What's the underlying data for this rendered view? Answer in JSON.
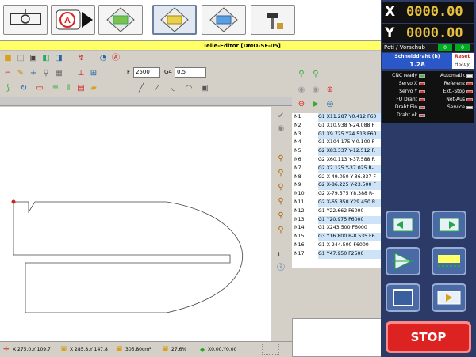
{
  "window_title": "Teile-Editor [DMO-SF-05]",
  "toolbar_icons": [
    "machine-icon",
    "auto-mode-icon",
    "diamond-folder-icon",
    "diamond-folder-edit-icon",
    "diamond-folder-open-icon",
    "hammer-icon"
  ],
  "row2_icons": [
    "open-folder-icon",
    "new-file-icon",
    "save-icon",
    "import-icon",
    "export-icon",
    "cursor-cut-icon",
    "timer-icon",
    "auto-icon"
  ],
  "row3": {
    "feed_label": "F",
    "feed_value": "2500",
    "g4_label": "G4",
    "g4_value": "0.5"
  },
  "right_panel": {
    "x_label": "X",
    "x_value": "0000.00",
    "y_label": "Y",
    "y_value": "0000.00",
    "poti_label": "Poti / Vorschub",
    "poti_a": "0",
    "poti_b": "0",
    "wire_title": "Schneiddraht (h)",
    "wire_value": "1.28",
    "reset": "Reset",
    "history": "Histoy",
    "status_left": [
      "CNC ready",
      "Servo X",
      "Servo Y",
      "FU Draht",
      "Draht Ein",
      "Draht ok"
    ],
    "status_left_colors": [
      "green",
      "red",
      "red",
      "red",
      "red",
      "red"
    ],
    "status_right": [
      "Automatik",
      "Referenz",
      "Ext.-Stop",
      "Not-Aus",
      "Service"
    ],
    "status_right_colors": [
      "white",
      "red",
      "red",
      "red",
      "white"
    ],
    "stop_label": "STOP"
  },
  "nc_rows": [
    {
      "n": "N1",
      "code": "G1 X11.287 Y0.412 F60"
    },
    {
      "n": "N2",
      "code": "G1 X10.938 Y-24.088 F"
    },
    {
      "n": "N3",
      "code": "G1 X9.725 Y24.513 F60"
    },
    {
      "n": "N4",
      "code": "G1 X104.175 Y-0.100 F"
    },
    {
      "n": "N5",
      "code": "G2 X83.337 Y-12.512 R"
    },
    {
      "n": "N6",
      "code": "G2 X60.113 Y-37.588 R"
    },
    {
      "n": "N7",
      "code": "G2 X2.125 Y-37.025 R-"
    },
    {
      "n": "N8",
      "code": "G2 X-49.050 Y-36.337 F"
    },
    {
      "n": "N9",
      "code": "G2 X-86.225 Y-23.500 F"
    },
    {
      "n": "N10",
      "code": "G2 X-79.575 Y8.388 R-"
    },
    {
      "n": "N11",
      "code": "G2 X-65.850 Y29.450 R"
    },
    {
      "n": "N12",
      "code": "G1 Y22.662 F6000"
    },
    {
      "n": "N13",
      "code": "G1 Y20.975 F6000"
    },
    {
      "n": "N14",
      "code": "G1 X243.500 F6000"
    },
    {
      "n": "N15",
      "code": "G3 Y16.800 R-8.535 F6"
    },
    {
      "n": "N16",
      "code": "G1 X-244.500 F6000"
    },
    {
      "n": "N17",
      "code": "G1 Y47.950 F2500"
    }
  ],
  "statusbar": {
    "cursor": "X 275.0,Y 109.7",
    "size": "X 285.8,Y 147.8",
    "area": "305.80cm²",
    "percent": "27.6%",
    "origin": "X0.00,Y0.00"
  }
}
